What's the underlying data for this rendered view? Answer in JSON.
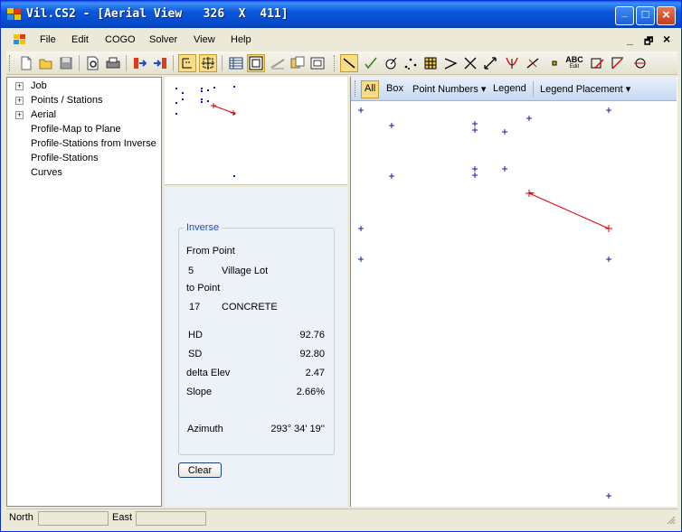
{
  "window": {
    "title": "Vil.CS2 - [Aerial View   326  X  411]"
  },
  "menu": {
    "file": "File",
    "edit": "Edit",
    "cogo": "COGO",
    "solver": "Solver",
    "view": "View",
    "help": "Help"
  },
  "caption_buttons": {
    "minimize": "_",
    "maximize": "□",
    "close": "×"
  },
  "mdi_controls": {
    "minimize": "_",
    "restore": "🗗",
    "close": "×"
  },
  "toolbar_icons": [
    "new-icon",
    "open-icon",
    "save-icon",
    "print-preview-icon",
    "print-icon",
    "import-icon",
    "export-icon",
    "aerial-view-icon",
    "zoom-extents-icon",
    "grid-icon",
    "plan-view-icon",
    "profile-icon",
    "copy-view-icon",
    "window-icon",
    "line-icon",
    "check-icon",
    "circle-target-icon",
    "points-icon",
    "table-icon",
    "angle-icon",
    "intersect-icon",
    "arrows-icon",
    "curve-icon",
    "offset-icon",
    "point-icon",
    "edit-text-icon",
    "measure-icon",
    "angle-measure-icon",
    "arc-icon"
  ],
  "edit_text_icon_label": "ABC",
  "edit_text_icon_sublabel": "Edit",
  "tree": {
    "items": [
      {
        "label": "Job",
        "expandable": true
      },
      {
        "label": "Points / Stations",
        "expandable": true
      },
      {
        "label": "Aerial",
        "expandable": true
      },
      {
        "label": "Profile-Map to Plane",
        "expandable": false
      },
      {
        "label": "Profile-Stations from Inverse",
        "expandable": false
      },
      {
        "label": "Profile-Stations",
        "expandable": false
      },
      {
        "label": "Curves",
        "expandable": false
      }
    ],
    "expander_glyph": "+"
  },
  "inverse": {
    "group_title": "Inverse",
    "from_label": "From Point",
    "from_number": "5",
    "from_desc": "Village Lot",
    "to_label": "to Point",
    "to_number": "17",
    "to_desc": "CONCRETE",
    "hd_label": "HD",
    "hd_value": "92.76",
    "sd_label": "SD",
    "sd_value": "92.80",
    "elev_label": "delta Elev",
    "elev_value": "2.47",
    "slope_label": "Slope",
    "slope_value": "2.66%",
    "azimuth_label": "Azimuth",
    "azimuth_value": "293° 34' 19''",
    "clear_label": "Clear"
  },
  "view_toolbar": {
    "all": "All",
    "box": "Box",
    "point_numbers": "Point Numbers",
    "legend": "Legend",
    "legend_placement": "Legend Placement",
    "dropdown_glyph": "▾"
  },
  "status": {
    "north_label": "North",
    "north_value": "",
    "east_label": "East",
    "east_value": ""
  },
  "colors": {
    "point_marker": "#1a1aa8",
    "inverse_line": "#e00000",
    "group_title": "#1f4cbd",
    "toolbar_checked": "#f8dc8a"
  }
}
